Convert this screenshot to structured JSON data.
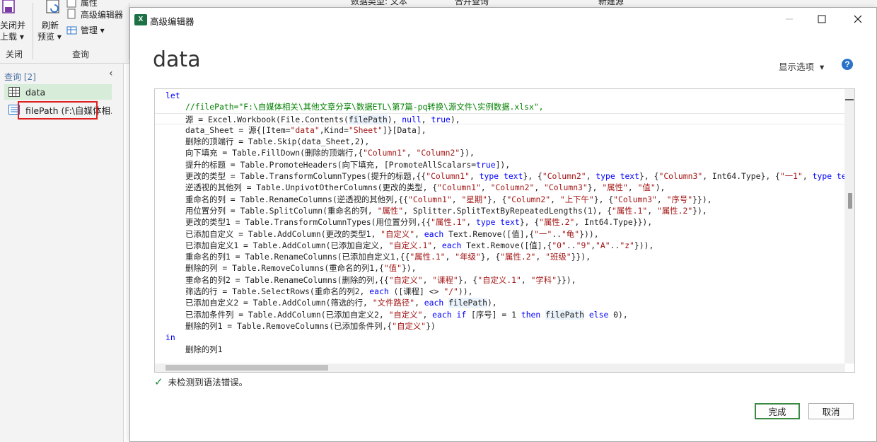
{
  "ribbon": {
    "close_load_label_1": "关闭并",
    "close_load_label_2": "上载",
    "refresh_label_1": "刷新",
    "refresh_label_2": "预览",
    "advanced_editor_label": "高级编辑器",
    "manage_label": "管理",
    "attribute_label": "属性",
    "group_close": "关闭",
    "group_query": "查询",
    "data_type_label": "数据类型: 文本",
    "merge_query_label": "合并查询",
    "new_source_label": "新建源"
  },
  "query_pane": {
    "header": "查询 [2]",
    "items": [
      {
        "label": "data",
        "selected": true
      },
      {
        "label": "filePath (F:\\自媒体相..."
      }
    ]
  },
  "dialog": {
    "window_title": "高级编辑器",
    "query_name": "data",
    "display_options": "显示选项",
    "help": "?",
    "status_text": "未检测到语法错误。",
    "done_button": "完成",
    "cancel_button": "取消"
  },
  "code_lines": [
    {
      "indent": false,
      "tokens": [
        {
          "t": "kw",
          "v": "let"
        }
      ]
    },
    {
      "indent": true,
      "tokens": [
        {
          "t": "com",
          "v": "//filePath=\"F:\\自媒体相关\\其他文章分享\\数据ETL\\第7篇-pq转换\\源文件\\实例数据.xlsx\","
        }
      ]
    },
    {
      "indent": true,
      "current": true,
      "tokens": [
        {
          "t": "p",
          "v": "源 = Excel.Workbook(File.Contents("
        },
        {
          "t": "ident",
          "v": "filePath"
        },
        {
          "t": "p",
          "v": "), "
        },
        {
          "t": "kw",
          "v": "null"
        },
        {
          "t": "p",
          "v": ", "
        },
        {
          "t": "kw",
          "v": "true"
        },
        {
          "t": "p",
          "v": "),"
        }
      ]
    },
    {
      "indent": true,
      "tokens": [
        {
          "t": "p",
          "v": "data_Sheet = 源{[Item="
        },
        {
          "t": "str",
          "v": "\"data\""
        },
        {
          "t": "p",
          "v": ",Kind="
        },
        {
          "t": "str",
          "v": "\"Sheet\""
        },
        {
          "t": "p",
          "v": "]}[Data],"
        }
      ]
    },
    {
      "indent": true,
      "tokens": [
        {
          "t": "p",
          "v": "删除的顶端行 = Table.Skip(data_Sheet,2),"
        }
      ]
    },
    {
      "indent": true,
      "tokens": [
        {
          "t": "p",
          "v": "向下填充 = Table.FillDown(删除的顶端行,{"
        },
        {
          "t": "str",
          "v": "\"Column1\""
        },
        {
          "t": "p",
          "v": ", "
        },
        {
          "t": "str",
          "v": "\"Column2\""
        },
        {
          "t": "p",
          "v": "}),"
        }
      ]
    },
    {
      "indent": true,
      "tokens": [
        {
          "t": "p",
          "v": "提升的标题 = Table.PromoteHeaders(向下填充, [PromoteAllScalars="
        },
        {
          "t": "kw",
          "v": "true"
        },
        {
          "t": "p",
          "v": "]),"
        }
      ]
    },
    {
      "indent": true,
      "tokens": [
        {
          "t": "p",
          "v": "更改的类型 = Table.TransformColumnTypes(提升的标题,{{"
        },
        {
          "t": "str",
          "v": "\"Column1\""
        },
        {
          "t": "p",
          "v": ", "
        },
        {
          "t": "kw",
          "v": "type text"
        },
        {
          "t": "p",
          "v": "}, {"
        },
        {
          "t": "str",
          "v": "\"Column2\""
        },
        {
          "t": "p",
          "v": ", "
        },
        {
          "t": "kw",
          "v": "type text"
        },
        {
          "t": "p",
          "v": "}, {"
        },
        {
          "t": "str",
          "v": "\"Column3\""
        },
        {
          "t": "p",
          "v": ", Int64.Type}, {"
        },
        {
          "t": "str",
          "v": "\"一1\""
        },
        {
          "t": "p",
          "v": ", "
        },
        {
          "t": "kw",
          "v": "type te"
        }
      ]
    },
    {
      "indent": true,
      "tokens": [
        {
          "t": "p",
          "v": "逆透视的其他列 = Table.UnpivotOtherColumns(更改的类型, {"
        },
        {
          "t": "str",
          "v": "\"Column1\""
        },
        {
          "t": "p",
          "v": ", "
        },
        {
          "t": "str",
          "v": "\"Column2\""
        },
        {
          "t": "p",
          "v": ", "
        },
        {
          "t": "str",
          "v": "\"Column3\""
        },
        {
          "t": "p",
          "v": "}, "
        },
        {
          "t": "str",
          "v": "\"属性\""
        },
        {
          "t": "p",
          "v": ", "
        },
        {
          "t": "str",
          "v": "\"值\""
        },
        {
          "t": "p",
          "v": "),"
        }
      ]
    },
    {
      "indent": true,
      "tokens": [
        {
          "t": "p",
          "v": "重命名的列 = Table.RenameColumns(逆透视的其他列,{{"
        },
        {
          "t": "str",
          "v": "\"Column1\""
        },
        {
          "t": "p",
          "v": ", "
        },
        {
          "t": "str",
          "v": "\"星期\""
        },
        {
          "t": "p",
          "v": "}, {"
        },
        {
          "t": "str",
          "v": "\"Column2\""
        },
        {
          "t": "p",
          "v": ", "
        },
        {
          "t": "str",
          "v": "\"上下午\""
        },
        {
          "t": "p",
          "v": "}, {"
        },
        {
          "t": "str",
          "v": "\"Column3\""
        },
        {
          "t": "p",
          "v": ", "
        },
        {
          "t": "str",
          "v": "\"序号\""
        },
        {
          "t": "p",
          "v": "}}),"
        }
      ]
    },
    {
      "indent": true,
      "tokens": [
        {
          "t": "p",
          "v": "用位置分列 = Table.SplitColumn(重命名的列, "
        },
        {
          "t": "str",
          "v": "\"属性\""
        },
        {
          "t": "p",
          "v": ", Splitter.SplitTextByRepeatedLengths(1), {"
        },
        {
          "t": "str",
          "v": "\"属性.1\""
        },
        {
          "t": "p",
          "v": ", "
        },
        {
          "t": "str",
          "v": "\"属性.2\""
        },
        {
          "t": "p",
          "v": "}),"
        }
      ]
    },
    {
      "indent": true,
      "tokens": [
        {
          "t": "p",
          "v": "更改的类型1 = Table.TransformColumnTypes(用位置分列,{{"
        },
        {
          "t": "str",
          "v": "\"属性.1\""
        },
        {
          "t": "p",
          "v": ", "
        },
        {
          "t": "kw",
          "v": "type text"
        },
        {
          "t": "p",
          "v": "}, {"
        },
        {
          "t": "str",
          "v": "\"属性.2\""
        },
        {
          "t": "p",
          "v": ", Int64.Type}}),"
        }
      ]
    },
    {
      "indent": true,
      "tokens": [
        {
          "t": "p",
          "v": "已添加自定义 = Table.AddColumn(更改的类型1, "
        },
        {
          "t": "str",
          "v": "\"自定义\""
        },
        {
          "t": "p",
          "v": ", "
        },
        {
          "t": "kw",
          "v": "each"
        },
        {
          "t": "p",
          "v": " Text.Remove([值],{"
        },
        {
          "t": "str",
          "v": "\"一\""
        },
        {
          "t": "p",
          "v": ".."
        },
        {
          "t": "str",
          "v": "\"龟\""
        },
        {
          "t": "p",
          "v": "})),"
        }
      ]
    },
    {
      "indent": true,
      "tokens": [
        {
          "t": "p",
          "v": "已添加自定义1 = Table.AddColumn(已添加自定义, "
        },
        {
          "t": "str",
          "v": "\"自定义.1\""
        },
        {
          "t": "p",
          "v": ", "
        },
        {
          "t": "kw",
          "v": "each"
        },
        {
          "t": "p",
          "v": " Text.Remove([值],{"
        },
        {
          "t": "str",
          "v": "\"0\""
        },
        {
          "t": "p",
          "v": ".."
        },
        {
          "t": "str",
          "v": "\"9\""
        },
        {
          "t": "p",
          "v": ","
        },
        {
          "t": "str",
          "v": "\"A\""
        },
        {
          "t": "p",
          "v": ".."
        },
        {
          "t": "str",
          "v": "\"z\""
        },
        {
          "t": "p",
          "v": "})),"
        }
      ]
    },
    {
      "indent": true,
      "tokens": [
        {
          "t": "p",
          "v": "重命名的列1 = Table.RenameColumns(已添加自定义1,{{"
        },
        {
          "t": "str",
          "v": "\"属性.1\""
        },
        {
          "t": "p",
          "v": ", "
        },
        {
          "t": "str",
          "v": "\"年级\""
        },
        {
          "t": "p",
          "v": "}, {"
        },
        {
          "t": "str",
          "v": "\"属性.2\""
        },
        {
          "t": "p",
          "v": ", "
        },
        {
          "t": "str",
          "v": "\"班级\""
        },
        {
          "t": "p",
          "v": "}}),"
        }
      ]
    },
    {
      "indent": true,
      "tokens": [
        {
          "t": "p",
          "v": "删除的列 = Table.RemoveColumns(重命名的列1,{"
        },
        {
          "t": "str",
          "v": "\"值\""
        },
        {
          "t": "p",
          "v": "}),"
        }
      ]
    },
    {
      "indent": true,
      "tokens": [
        {
          "t": "p",
          "v": "重命名的列2 = Table.RenameColumns(删除的列,{{"
        },
        {
          "t": "str",
          "v": "\"自定义\""
        },
        {
          "t": "p",
          "v": ", "
        },
        {
          "t": "str",
          "v": "\"课程\""
        },
        {
          "t": "p",
          "v": "}, {"
        },
        {
          "t": "str",
          "v": "\"自定义.1\""
        },
        {
          "t": "p",
          "v": ", "
        },
        {
          "t": "str",
          "v": "\"学科\""
        },
        {
          "t": "p",
          "v": "}}),"
        }
      ]
    },
    {
      "indent": true,
      "tokens": [
        {
          "t": "p",
          "v": "筛选的行 = Table.SelectRows(重命名的列2, "
        },
        {
          "t": "kw",
          "v": "each"
        },
        {
          "t": "p",
          "v": " ([课程] <> "
        },
        {
          "t": "str",
          "v": "\"/\""
        },
        {
          "t": "p",
          "v": ")),"
        }
      ]
    },
    {
      "indent": true,
      "tokens": [
        {
          "t": "p",
          "v": "已添加自定义2 = Table.AddColumn(筛选的行, "
        },
        {
          "t": "str",
          "v": "\"文件路径\""
        },
        {
          "t": "p",
          "v": ", "
        },
        {
          "t": "kw",
          "v": "each"
        },
        {
          "t": "p",
          "v": " "
        },
        {
          "t": "ident",
          "v": "filePath"
        },
        {
          "t": "p",
          "v": "),"
        }
      ]
    },
    {
      "indent": true,
      "tokens": [
        {
          "t": "p",
          "v": "已添加条件列 = Table.AddColumn(已添加自定义2, "
        },
        {
          "t": "str",
          "v": "\"自定义\""
        },
        {
          "t": "p",
          "v": ", "
        },
        {
          "t": "kw",
          "v": "each if"
        },
        {
          "t": "p",
          "v": " [序号] = 1 "
        },
        {
          "t": "kw",
          "v": "then"
        },
        {
          "t": "p",
          "v": " "
        },
        {
          "t": "ident",
          "v": "filePath"
        },
        {
          "t": "p",
          "v": " "
        },
        {
          "t": "kw",
          "v": "else"
        },
        {
          "t": "p",
          "v": " 0),"
        }
      ]
    },
    {
      "indent": true,
      "tokens": [
        {
          "t": "p",
          "v": "删除的列1 = Table.RemoveColumns(已添加条件列,{"
        },
        {
          "t": "str",
          "v": "\"自定义\""
        },
        {
          "t": "p",
          "v": "})"
        }
      ]
    },
    {
      "indent": false,
      "tokens": [
        {
          "t": "kw",
          "v": "in"
        }
      ]
    },
    {
      "indent": true,
      "tokens": [
        {
          "t": "p",
          "v": "删除的列1"
        }
      ]
    }
  ]
}
